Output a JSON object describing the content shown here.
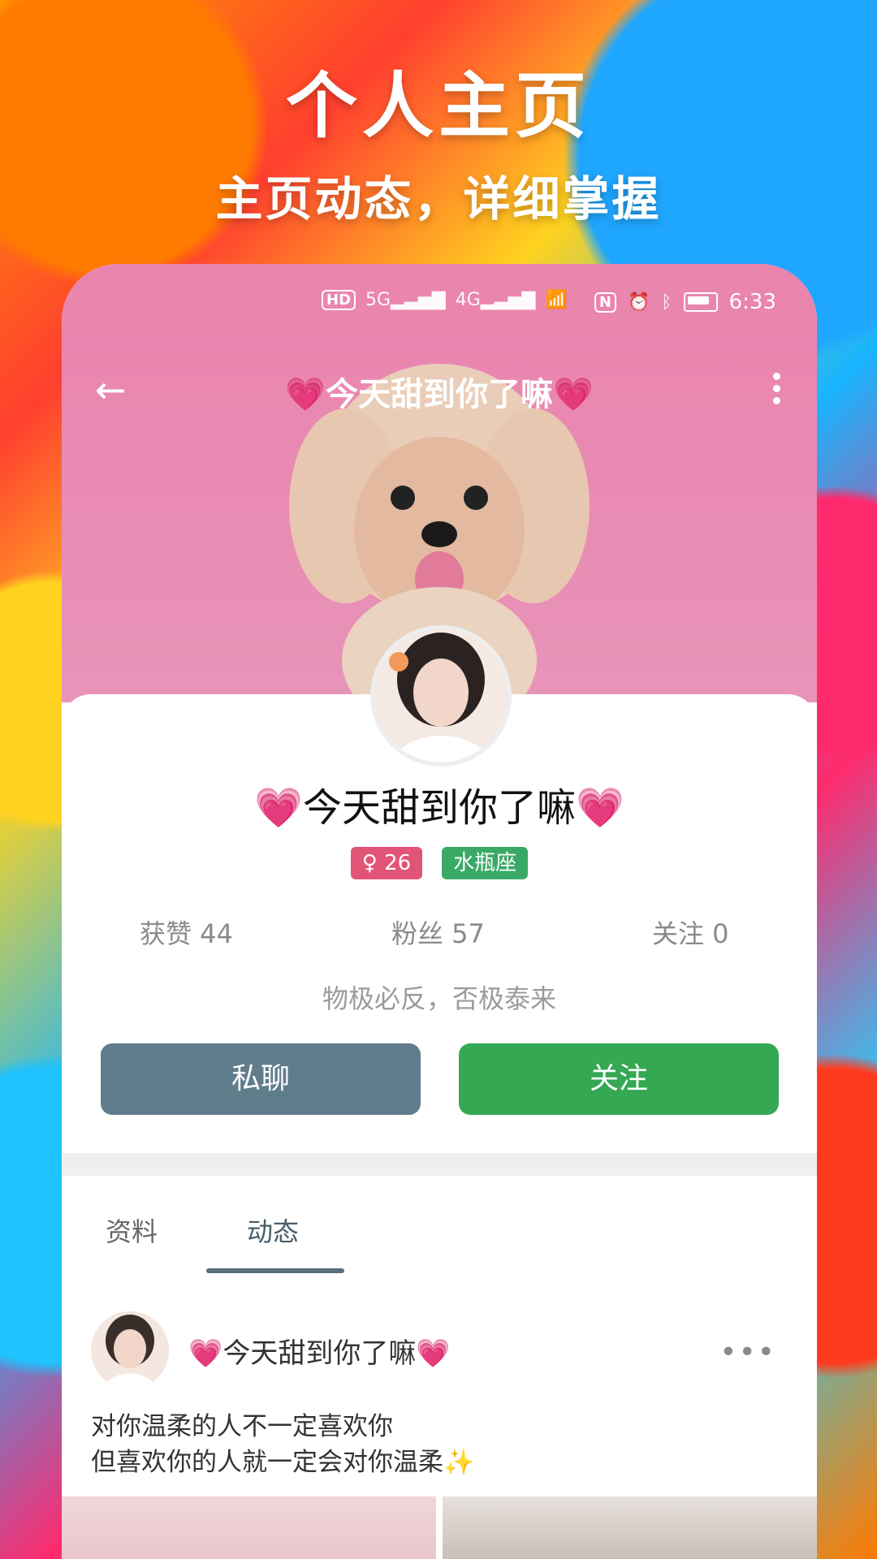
{
  "promo": {
    "title": "个人主页",
    "subtitle": "主页动态，详细掌握"
  },
  "status_bar": {
    "left": [
      "HD",
      "5G",
      "4G",
      "wifi"
    ],
    "time": "6:33",
    "icons": [
      "nfc-icon",
      "alarm-icon",
      "bluetooth-icon",
      "battery-icon"
    ]
  },
  "nav": {
    "title": "💗今天甜到你了嘛💗"
  },
  "profile": {
    "name": "💗今天甜到你了嘛💗",
    "gender_age": "♀ 26",
    "zodiac": "水瓶座",
    "likes": "获赞 44",
    "fans": "粉丝 57",
    "following": "关注 0",
    "motto": "物极必反，否极泰来",
    "chat_label": "私聊",
    "follow_label": "关注"
  },
  "tabs": [
    {
      "label": "资料"
    },
    {
      "label": "动态"
    }
  ],
  "post": {
    "author": "💗今天甜到你了嘛💗",
    "text_line1": "对你温柔的人不一定喜欢你",
    "text_line2": "但喜欢你的人就一定会对你温柔✨"
  }
}
